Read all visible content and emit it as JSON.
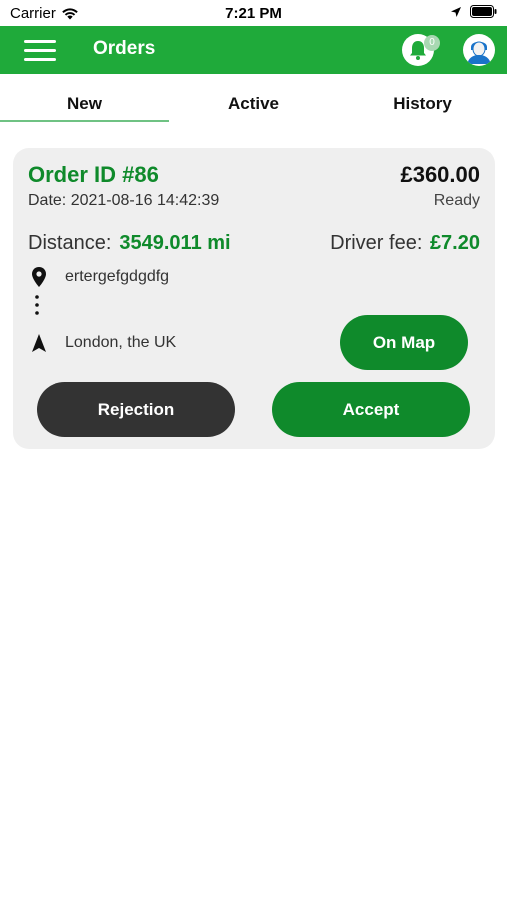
{
  "status_bar": {
    "carrier": "Carrier",
    "time": "7:21 PM"
  },
  "header": {
    "title": "Orders",
    "notification_count": "0",
    "brand_color": "#1faa3a"
  },
  "tabs": [
    {
      "label": "New",
      "selected": true
    },
    {
      "label": "Active",
      "selected": false
    },
    {
      "label": "History",
      "selected": false
    }
  ],
  "order": {
    "id_label": "Order ID #86",
    "date": "Date: 2021-08-16 14:42:39",
    "price": "£360.00",
    "status": "Ready",
    "distance_label": "Distance:",
    "distance_value": "3549.011 mi",
    "fee_label": "Driver fee:",
    "fee_value": "£7.20",
    "pickup_address": "ertergefgdgdfg",
    "destination": "London, the UK",
    "map_button": "On Map",
    "reject_button": "Rejection",
    "accept_button": "Accept",
    "accent_color": "#0f8a2b"
  },
  "icons": {
    "pickup": "location-pin-icon",
    "route": "vertical-dots-icon",
    "destination": "navigation-arrow-icon",
    "notifications": "bell-icon",
    "profile": "avatar-icon",
    "menu": "hamburger-icon"
  }
}
